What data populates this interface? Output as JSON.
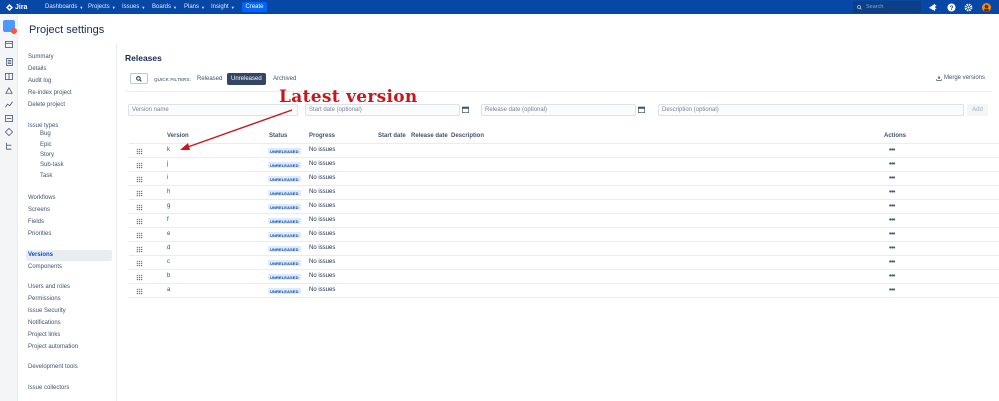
{
  "topnav": {
    "logo": "Jira",
    "menus": [
      "Dashboards",
      "Projects",
      "Issues",
      "Boards",
      "Plans",
      "Insight"
    ],
    "create": "Create",
    "search_placeholder": "Search",
    "colors": {
      "bar": "#0747a6",
      "create": "#0065ff"
    }
  },
  "page": {
    "title": "Project settings"
  },
  "sidebar": {
    "items": [
      {
        "label": "Summary"
      },
      {
        "label": "Details"
      },
      {
        "label": "Audit log"
      },
      {
        "label": "Re-index project"
      },
      {
        "label": "Delete project"
      },
      {
        "label": "Issue types"
      },
      {
        "label": "Bug"
      },
      {
        "label": "Epic"
      },
      {
        "label": "Story"
      },
      {
        "label": "Sub-task"
      },
      {
        "label": "Task"
      },
      {
        "label": "Workflows"
      },
      {
        "label": "Screens"
      },
      {
        "label": "Fields"
      },
      {
        "label": "Priorities"
      },
      {
        "label": "Versions"
      },
      {
        "label": "Components"
      },
      {
        "label": "Users and roles"
      },
      {
        "label": "Permissions"
      },
      {
        "label": "Issue Security"
      },
      {
        "label": "Notifications"
      },
      {
        "label": "Project links"
      },
      {
        "label": "Project automation"
      },
      {
        "label": "Development tools"
      },
      {
        "label": "Issue collectors"
      }
    ]
  },
  "releases": {
    "title": "Releases",
    "quick_filters_label": "QUICK FILTERS:",
    "filters": [
      "Released",
      "Unreleased",
      "Archived"
    ],
    "active_filter": "Unreleased",
    "merge_label": "Merge versions",
    "form": {
      "version_name": "Version name",
      "start_date": "Start date (optional)",
      "release_date": "Release date (optional)",
      "description": "Description (optional)",
      "add": "Add"
    },
    "headers": {
      "version": "Version",
      "status": "Status",
      "progress": "Progress",
      "start_date": "Start date",
      "release_date": "Release date",
      "description": "Description",
      "actions": "Actions"
    },
    "rows": [
      {
        "version": "k",
        "status": "UNRELEASED",
        "progress": "No issues"
      },
      {
        "version": "j",
        "status": "UNRELEASED",
        "progress": "No issues"
      },
      {
        "version": "i",
        "status": "UNRELEASED",
        "progress": "No issues"
      },
      {
        "version": "h",
        "status": "UNRELEASED",
        "progress": "No issues"
      },
      {
        "version": "g",
        "status": "UNRELEASED",
        "progress": "No issues"
      },
      {
        "version": "f",
        "status": "UNRELEASED",
        "progress": "No issues"
      },
      {
        "version": "e",
        "status": "UNRELEASED",
        "progress": "No issues"
      },
      {
        "version": "d",
        "status": "UNRELEASED",
        "progress": "No issues"
      },
      {
        "version": "c",
        "status": "UNRELEASED",
        "progress": "No issues"
      },
      {
        "version": "b",
        "status": "UNRELEASED",
        "progress": "No issues"
      },
      {
        "version": "a",
        "status": "UNRELEASED",
        "progress": "No issues"
      }
    ],
    "actions_glyph": "•••"
  },
  "annotation": {
    "text": "Latest version",
    "color": "#c9161b"
  }
}
